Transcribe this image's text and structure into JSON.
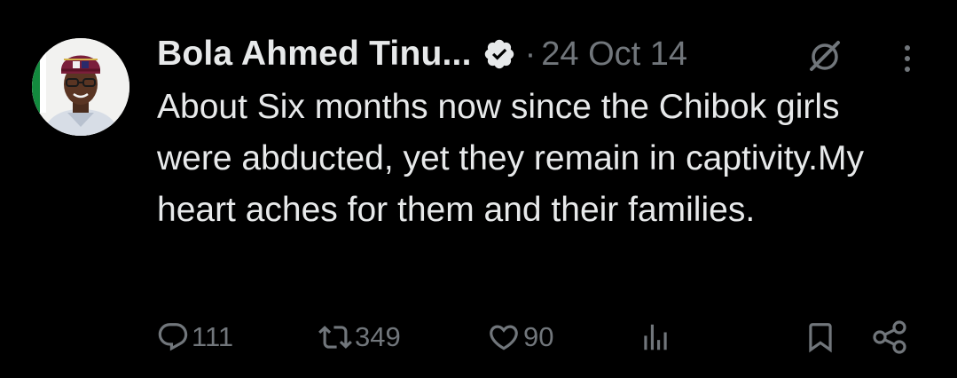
{
  "tweet": {
    "display_name": "Bola Ahmed Tinu...",
    "separator": "·",
    "date": "24 Oct 14",
    "text": "About Six months now since the Chibok girls were abducted, yet they remain in captivity.My heart aches for them and their families.",
    "avatar_icon": "profile-photo",
    "verified_icon": "verified-badge-icon",
    "verified_color": "#1d9bf0"
  },
  "actions": {
    "replies": "111",
    "reposts": "349",
    "likes": "90"
  },
  "colors": {
    "background": "#000000",
    "text": "#e7e9ea",
    "muted": "#71767b"
  }
}
